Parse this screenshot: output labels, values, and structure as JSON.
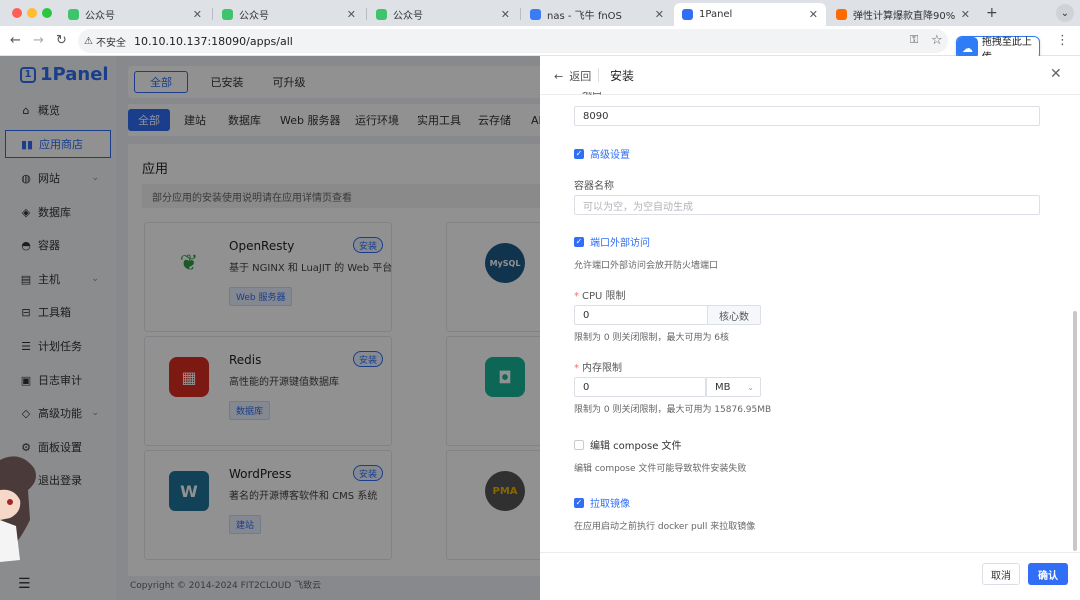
{
  "browser": {
    "tabs": [
      {
        "label": "公众号",
        "color": "#3ec46d"
      },
      {
        "label": "公众号",
        "color": "#3ec46d"
      },
      {
        "label": "公众号",
        "color": "#3ec46d"
      },
      {
        "label": "nas - 飞牛 fnOS",
        "color": "#3a7cf5"
      },
      {
        "label": "1Panel",
        "color": "#2f6ef5"
      },
      {
        "label": "弹性计算爆款直降90%!",
        "color": "#ff6a00"
      }
    ],
    "insecure_label": "不安全",
    "url": "10.10.10.137:18090/apps/all",
    "extension_label": "拖拽至此上传"
  },
  "sidebar": {
    "logo": "1Panel",
    "items": [
      {
        "label": "概览",
        "icon": "home-icon"
      },
      {
        "label": "应用商店",
        "icon": "app-store-icon"
      },
      {
        "label": "网站",
        "icon": "globe-icon"
      },
      {
        "label": "数据库",
        "icon": "database-icon"
      },
      {
        "label": "容器",
        "icon": "container-icon"
      },
      {
        "label": "主机",
        "icon": "host-icon"
      },
      {
        "label": "工具箱",
        "icon": "toolbox-icon"
      },
      {
        "label": "计划任务",
        "icon": "schedule-icon"
      },
      {
        "label": "日志审计",
        "icon": "log-icon"
      },
      {
        "label": "高级功能",
        "icon": "diamond-icon"
      },
      {
        "label": "面板设置",
        "icon": "gear-icon"
      },
      {
        "label": "退出登录",
        "icon": "logout-icon"
      }
    ]
  },
  "main": {
    "tabs": [
      "全部",
      "已安装",
      "可升级"
    ],
    "categories": [
      "全部",
      "建站",
      "数据库",
      "Web 服务器",
      "运行环境",
      "实用工具",
      "云存储",
      "AI"
    ],
    "section_title": "应用",
    "notice": "部分应用的安装使用说明请在应用详情页查看",
    "install_label": "安装",
    "apps": [
      {
        "name": "OpenResty",
        "desc": "基于 NGINX 和 LuaJIT 的 Web 平台",
        "tag": "Web 服务器",
        "color": "#ffffff"
      },
      {
        "name": "Redis",
        "desc": "高性能的开源键值数据库",
        "tag": "数据库",
        "color": "#ffffff"
      },
      {
        "name": "WordPress",
        "desc": "著名的开源博客软件和 CMS 系统",
        "tag": "建站",
        "color": "#ffffff"
      }
    ],
    "copyright": "Copyright © 2014-2024 FIT2CLOUD 飞致云"
  },
  "panel": {
    "back_label": "返回",
    "title": "安装",
    "port_label": "端口",
    "port_value": "8090",
    "advanced_label": "高级设置",
    "container_name_label": "容器名称",
    "container_name_placeholder": "可以为空，为空自动生成",
    "external_access_label": "端口外部访问",
    "external_access_hint": "允许端口外部访问会放开防火墙端口",
    "cpu_label": "CPU 限制",
    "cpu_value": "0",
    "cpu_unit": "核心数",
    "cpu_hint": "限制为 0 则关闭限制，最大可用为 6核",
    "mem_label": "内存限制",
    "mem_value": "0",
    "mem_unit": "MB",
    "mem_hint": "限制为 0 则关闭限制，最大可用为 15876.95MB",
    "compose_label": "编辑 compose 文件",
    "compose_hint": "编辑 compose 文件可能导致软件安装失败",
    "pull_label": "拉取镜像",
    "pull_hint": "在应用启动之前执行 docker pull 来拉取镜像",
    "cancel_label": "取消",
    "confirm_label": "确认"
  }
}
